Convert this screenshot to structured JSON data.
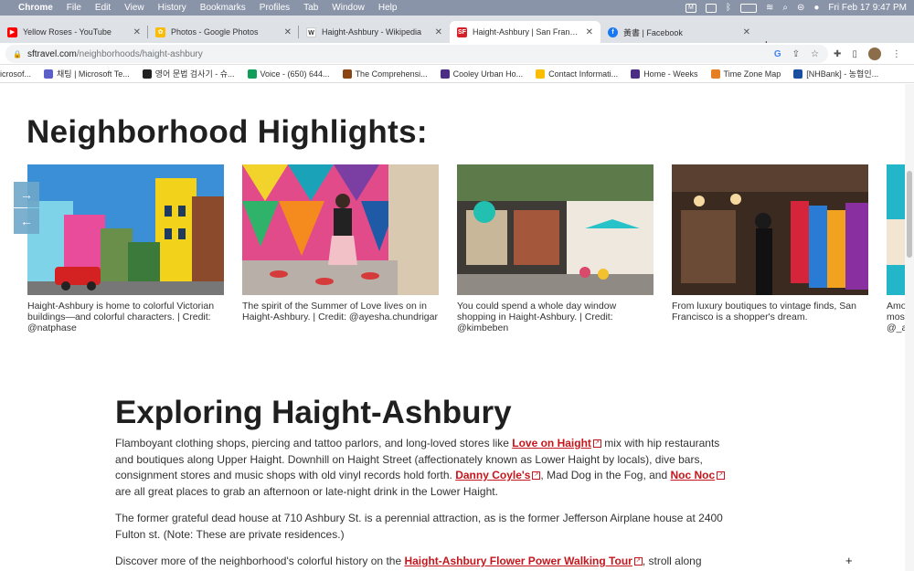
{
  "menubar": {
    "app": "Chrome",
    "items": [
      "File",
      "Edit",
      "View",
      "History",
      "Bookmarks",
      "Profiles",
      "Tab",
      "Window",
      "Help"
    ],
    "clock": "Fri Feb 17  9:47 PM"
  },
  "tabs": [
    {
      "title": "Yellow Roses - YouTube",
      "fav": "▶",
      "color": "#ff0000"
    },
    {
      "title": "Photos - Google Photos",
      "fav": "✿",
      "color": "#fbbc04"
    },
    {
      "title": "Haight-Ashbury - Wikipedia",
      "fav": "W",
      "color": "#555555"
    },
    {
      "title": "Haight-Ashbury | San Francisco",
      "fav": "SF",
      "color": "#d62027"
    },
    {
      "title": "黃書 | Facebook",
      "fav": "f",
      "color": "#1877f2"
    }
  ],
  "address": {
    "domain": "sftravel.com",
    "path": "/neighborhoods/haight-ashbury"
  },
  "bookmarks": [
    {
      "label": "icrosof...",
      "color": "#ffffff"
    },
    {
      "label": "채팅 | Microsoft Te...",
      "color": "#5b5fc7"
    },
    {
      "label": "영어 문법 검사기 - 슈...",
      "color": "#222222"
    },
    {
      "label": "Voice - (650) 644...",
      "color": "#0f9d58"
    },
    {
      "label": "The Comprehensi...",
      "color": "#8b4513"
    },
    {
      "label": "Cooley Urban Ho...",
      "color": "#4b2e83"
    },
    {
      "label": "Contact Informati...",
      "color": "#fbbc04"
    },
    {
      "label": "Home - Weeks",
      "color": "#4b2e83"
    },
    {
      "label": "Time Zone Map",
      "color": "#e67e22"
    },
    {
      "label": "[NHBank] - 농협인...",
      "color": "#1a4fa0"
    }
  ],
  "page": {
    "highlights_title": "Neighborhood Highlights:",
    "cards": [
      {
        "caption": "Haight-Ashbury is home to colorful Victorian buildings—and colorful characters. | Credit: @natphase"
      },
      {
        "caption": "The spirit of the Summer of Love lives on in Haight-Ashbury. | Credit: @ayesha.chundrigar"
      },
      {
        "caption": "You could spend a whole day window shopping in Haight-Ashbury. | Credit: @kimbeben"
      },
      {
        "caption": "From luxury boutiques to vintage finds, San Francisco is a shopper's dream."
      },
      {
        "caption": "Amo... mos... @_a..."
      }
    ],
    "carousel_next": "→",
    "carousel_prev": "←",
    "explore_title": "Exploring Haight-Ashbury",
    "p1": {
      "t1": "Flamboyant clothing shops, piercing and tattoo parlors, and long-loved stores like ",
      "l1": "Love on Haight",
      "t2": " mix with hip restaurants and boutiques along Upper Haight. Downhill on Haight Street (affectionately known as Lower Haight by locals), dive bars, consignment stores and music shops with old vinyl records hold forth. ",
      "l2": "Danny Coyle's",
      "t3": ", Mad Dog in the Fog, and ",
      "l3": "Noc Noc",
      "t4": " are all great places to grab an afternoon or late-night drink in the Lower Haight."
    },
    "p2": "The former grateful dead house at 710 Ashbury St. is a perennial attraction, as is the former Jefferson Airplane house at 2400 Fulton st. (Note: These are private residences.)",
    "p3": {
      "t1": "Discover more of the neighborhood's colorful history on the ",
      "l1": "Haight-Ashbury Flower Power Walking Tour",
      "t2": ", stroll along"
    },
    "plus": "+"
  }
}
